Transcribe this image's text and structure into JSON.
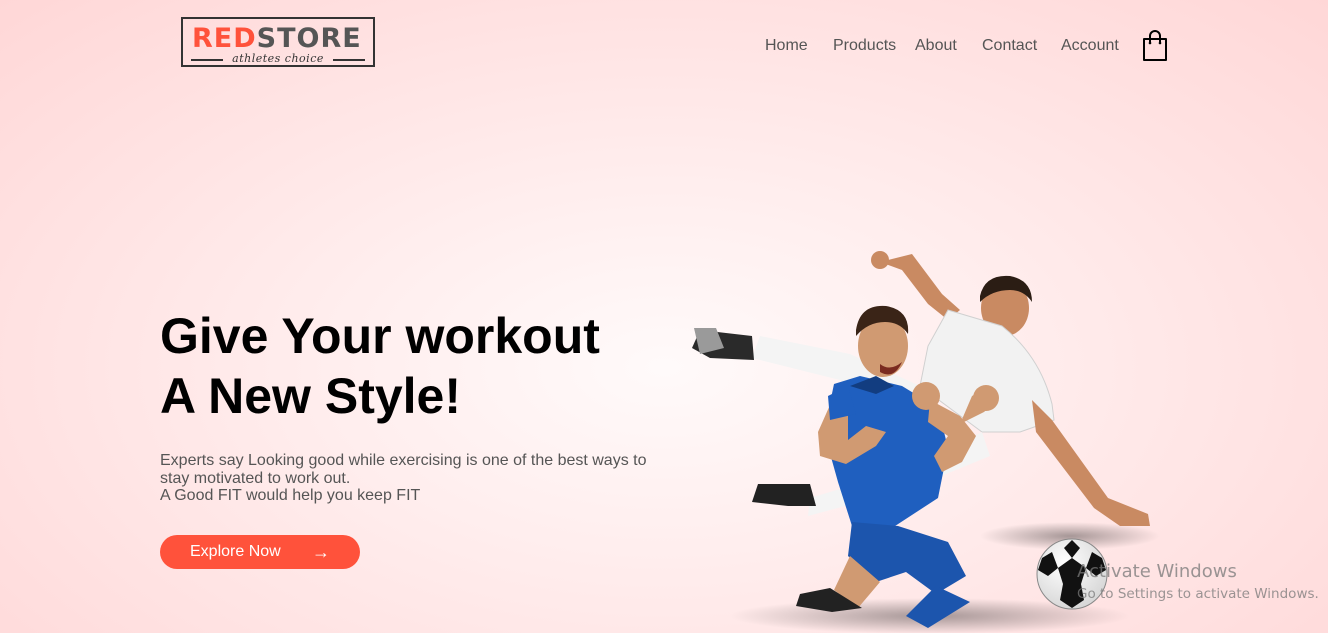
{
  "brand": {
    "logo_red": "RED",
    "logo_dark": "STORE",
    "tagline": "athletes choice"
  },
  "nav": {
    "items": [
      {
        "label": "Home"
      },
      {
        "label": "Products"
      },
      {
        "label": "About"
      },
      {
        "label": "Contact"
      },
      {
        "label": "Account"
      }
    ],
    "cart_icon": "shopping-bag-icon"
  },
  "hero": {
    "title_line1": "Give Your workout",
    "title_line2": "A New Style!",
    "description_line1": "Experts say Looking good while exercising is one of the best ways to",
    "description_line2": "stay motivated to work out.",
    "description_line3": "A Good FIT would help you keep FIT",
    "button_label": "Explore Now",
    "button_arrow": "→",
    "image_icon": "soccer-players-image"
  },
  "watermark": {
    "title": "Activate Windows",
    "subtitle": "Go to Settings to activate Windows."
  },
  "colors": {
    "accent": "#ff523b",
    "text": "#555555",
    "heading": "#000000",
    "background": "#ffd6d6"
  }
}
